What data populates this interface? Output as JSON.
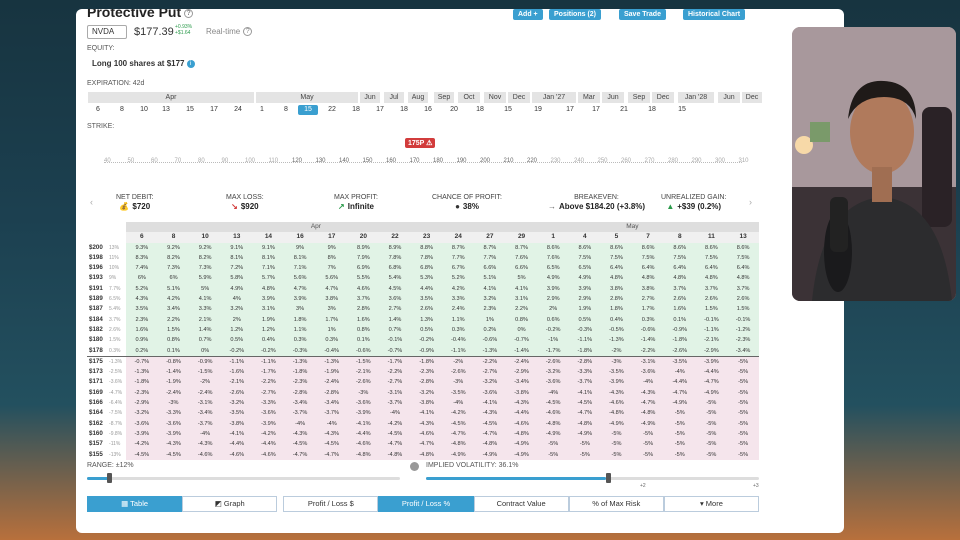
{
  "title": "Protective Put",
  "toolbar": [
    "Add +",
    "Positions (2)",
    "Save Trade",
    "Historical Chart"
  ],
  "ticker": "NVDA",
  "price": "$177.39",
  "change_pct": "+0.93%",
  "change_abs": "+$1.64",
  "realtime": "Real-time",
  "equity_label": "EQUITY:",
  "equity_value": "Long 100 shares at $177",
  "expiration_label": "EXPIRATION: 42d",
  "months": [
    "Apr",
    "May",
    "Jun",
    "Jul",
    "Aug",
    "Sep",
    "Oct",
    "Nov",
    "Dec",
    "Jan '27",
    "Mar",
    "Jun",
    "Sep",
    "Dec",
    "Jan '28",
    "Jun",
    "Dec"
  ],
  "dates": [
    "6",
    "8",
    "10",
    "13",
    "15",
    "17",
    "24",
    "1",
    "8",
    "15",
    "22",
    "18",
    "17",
    "18",
    "16",
    "20",
    "18",
    "15",
    "19",
    "17",
    "17",
    "21",
    "18",
    "15"
  ],
  "selected_date_index": 9,
  "strike_label": "STRIKE:",
  "strikes": [
    "40",
    "50",
    "60",
    "70",
    "80",
    "90",
    "100",
    "110",
    "120",
    "130",
    "140",
    "150",
    "160",
    "170",
    "180",
    "190",
    "200",
    "210",
    "220",
    "230",
    "240",
    "250",
    "260",
    "270",
    "280",
    "290",
    "300",
    "310"
  ],
  "strike_marker": "175P",
  "stats": [
    {
      "label": "NET DEBIT:",
      "value": "$720",
      "icon": "money-bag-icon"
    },
    {
      "label": "MAX LOSS:",
      "value": "$920",
      "icon": "down-arrow-icon"
    },
    {
      "label": "MAX PROFIT:",
      "value": "Infinite",
      "icon": "up-arrow-icon"
    },
    {
      "label": "CHANCE OF PROFIT:",
      "value": "38%",
      "icon": "dice-icon"
    },
    {
      "label": "BREAKEVEN:",
      "value": "Above $184.20 (+3.8%)",
      "icon": "arrow-right-icon"
    },
    {
      "label": "UNREALIZED GAIN:",
      "value": "+$39 (0.2%)",
      "icon": "triangle-up-icon"
    }
  ],
  "grid": {
    "month_headers": [
      {
        "label": "Apr",
        "span": 12
      },
      {
        "label": "May",
        "span": 8
      }
    ],
    "columns": [
      "6",
      "8",
      "10",
      "13",
      "14",
      "16",
      "17",
      "20",
      "22",
      "23",
      "24",
      "27",
      "29",
      "1",
      "4",
      "5",
      "7",
      "8",
      "11",
      "13",
      "15"
    ],
    "rows": [
      {
        "price": "$200",
        "pct": "13%",
        "vals": [
          "9.3%",
          "9.2%",
          "9.2%",
          "9.1%",
          "9.1%",
          "9%",
          "9%",
          "8.9%",
          "8.9%",
          "8.8%",
          "8.7%",
          "8.7%",
          "8.7%",
          "8.6%",
          "8.6%",
          "8.6%",
          "8.6%",
          "8.6%",
          "8.6%",
          "8.6%"
        ]
      },
      {
        "price": "$198",
        "pct": "11%",
        "vals": [
          "8.3%",
          "8.2%",
          "8.2%",
          "8.1%",
          "8.1%",
          "8.1%",
          "8%",
          "7.9%",
          "7.8%",
          "7.8%",
          "7.7%",
          "7.7%",
          "7.6%",
          "7.6%",
          "7.5%",
          "7.5%",
          "7.5%",
          "7.5%",
          "7.5%",
          "7.5%"
        ]
      },
      {
        "price": "$196",
        "pct": "10%",
        "vals": [
          "7.4%",
          "7.3%",
          "7.3%",
          "7.2%",
          "7.1%",
          "7.1%",
          "7%",
          "6.9%",
          "6.8%",
          "6.8%",
          "6.7%",
          "6.6%",
          "6.6%",
          "6.5%",
          "6.5%",
          "6.4%",
          "6.4%",
          "6.4%",
          "6.4%",
          "6.4%"
        ]
      },
      {
        "price": "$193",
        "pct": "9%",
        "vals": [
          "6%",
          "6%",
          "5.9%",
          "5.8%",
          "5.7%",
          "5.6%",
          "5.6%",
          "5.5%",
          "5.4%",
          "5.3%",
          "5.2%",
          "5.1%",
          "5%",
          "4.9%",
          "4.9%",
          "4.8%",
          "4.8%",
          "4.8%",
          "4.8%",
          "4.8%"
        ]
      },
      {
        "price": "$191",
        "pct": "7.7%",
        "vals": [
          "5.2%",
          "5.1%",
          "5%",
          "4.9%",
          "4.8%",
          "4.7%",
          "4.7%",
          "4.6%",
          "4.5%",
          "4.4%",
          "4.2%",
          "4.1%",
          "4.1%",
          "3.9%",
          "3.9%",
          "3.8%",
          "3.8%",
          "3.7%",
          "3.7%",
          "3.7%"
        ]
      },
      {
        "price": "$189",
        "pct": "6.5%",
        "vals": [
          "4.3%",
          "4.2%",
          "4.1%",
          "4%",
          "3.9%",
          "3.9%",
          "3.8%",
          "3.7%",
          "3.6%",
          "3.5%",
          "3.3%",
          "3.2%",
          "3.1%",
          "2.9%",
          "2.9%",
          "2.8%",
          "2.7%",
          "2.6%",
          "2.6%",
          "2.6%"
        ]
      },
      {
        "price": "$187",
        "pct": "5.4%",
        "vals": [
          "3.5%",
          "3.4%",
          "3.3%",
          "3.2%",
          "3.1%",
          "3%",
          "3%",
          "2.8%",
          "2.7%",
          "2.6%",
          "2.4%",
          "2.3%",
          "2.2%",
          "2%",
          "1.9%",
          "1.8%",
          "1.7%",
          "1.6%",
          "1.5%",
          "1.5%"
        ]
      },
      {
        "price": "$184",
        "pct": "3.7%",
        "vals": [
          "2.3%",
          "2.2%",
          "2.1%",
          "2%",
          "1.9%",
          "1.8%",
          "1.7%",
          "1.6%",
          "1.4%",
          "1.3%",
          "1.1%",
          "1%",
          "0.8%",
          "0.6%",
          "0.5%",
          "0.4%",
          "0.3%",
          "0.1%",
          "-0.1%",
          "-0.1%"
        ]
      },
      {
        "price": "$182",
        "pct": "2.6%",
        "vals": [
          "1.6%",
          "1.5%",
          "1.4%",
          "1.2%",
          "1.2%",
          "1.1%",
          "1%",
          "0.8%",
          "0.7%",
          "0.5%",
          "0.3%",
          "0.2%",
          "0%",
          "-0.2%",
          "-0.3%",
          "-0.5%",
          "-0.6%",
          "-0.9%",
          "-1.1%",
          "-1.2%"
        ]
      },
      {
        "price": "$180",
        "pct": "1.5%",
        "vals": [
          "0.9%",
          "0.8%",
          "0.7%",
          "0.5%",
          "0.4%",
          "0.3%",
          "0.3%",
          "0.1%",
          "-0.1%",
          "-0.2%",
          "-0.4%",
          "-0.6%",
          "-0.7%",
          "-1%",
          "-1.1%",
          "-1.3%",
          "-1.4%",
          "-1.8%",
          "-2.1%",
          "-2.3%"
        ]
      },
      {
        "price": "$178",
        "pct": "0.3%",
        "vals": [
          "0.2%",
          "0.1%",
          "0%",
          "-0.2%",
          "-0.2%",
          "-0.3%",
          "-0.4%",
          "-0.6%",
          "-0.7%",
          "-0.9%",
          "-1.1%",
          "-1.3%",
          "-1.4%",
          "-1.7%",
          "-1.8%",
          "-2%",
          "-2.2%",
          "-2.6%",
          "-2.9%",
          "-3.4%"
        ]
      },
      {
        "price": "$175",
        "pct": "-1.3%",
        "vals": [
          "-0.7%",
          "-0.8%",
          "-0.9%",
          "-1.1%",
          "-1.1%",
          "-1.3%",
          "-1.3%",
          "-1.5%",
          "-1.7%",
          "-1.8%",
          "-2%",
          "-2.2%",
          "-2.4%",
          "-2.6%",
          "-2.8%",
          "-3%",
          "-3.1%",
          "-3.5%",
          "-3.9%",
          "-5%"
        ]
      },
      {
        "price": "$173",
        "pct": "-2.5%",
        "vals": [
          "-1.3%",
          "-1.4%",
          "-1.5%",
          "-1.6%",
          "-1.7%",
          "-1.8%",
          "-1.9%",
          "-2.1%",
          "-2.2%",
          "-2.3%",
          "-2.6%",
          "-2.7%",
          "-2.9%",
          "-3.2%",
          "-3.3%",
          "-3.5%",
          "-3.6%",
          "-4%",
          "-4.4%",
          "-5%"
        ]
      },
      {
        "price": "$171",
        "pct": "-3.6%",
        "vals": [
          "-1.8%",
          "-1.9%",
          "-2%",
          "-2.1%",
          "-2.2%",
          "-2.3%",
          "-2.4%",
          "-2.6%",
          "-2.7%",
          "-2.8%",
          "-3%",
          "-3.2%",
          "-3.4%",
          "-3.6%",
          "-3.7%",
          "-3.9%",
          "-4%",
          "-4.4%",
          "-4.7%",
          "-5%"
        ]
      },
      {
        "price": "$169",
        "pct": "-4.7%",
        "vals": [
          "-2.3%",
          "-2.4%",
          "-2.4%",
          "-2.6%",
          "-2.7%",
          "-2.8%",
          "-2.8%",
          "-3%",
          "-3.1%",
          "-3.2%",
          "-3.5%",
          "-3.6%",
          "-3.8%",
          "-4%",
          "-4.1%",
          "-4.3%",
          "-4.3%",
          "-4.7%",
          "-4.9%",
          "-5%"
        ]
      },
      {
        "price": "$166",
        "pct": "-6.4%",
        "vals": [
          "-2.9%",
          "-3%",
          "-3.1%",
          "-3.2%",
          "-3.3%",
          "-3.4%",
          "-3.4%",
          "-3.6%",
          "-3.7%",
          "-3.8%",
          "-4%",
          "-4.1%",
          "-4.3%",
          "-4.5%",
          "-4.5%",
          "-4.6%",
          "-4.7%",
          "-4.9%",
          "-5%",
          "-5%"
        ]
      },
      {
        "price": "$164",
        "pct": "-7.5%",
        "vals": [
          "-3.2%",
          "-3.3%",
          "-3.4%",
          "-3.5%",
          "-3.6%",
          "-3.7%",
          "-3.7%",
          "-3.9%",
          "-4%",
          "-4.1%",
          "-4.2%",
          "-4.3%",
          "-4.4%",
          "-4.6%",
          "-4.7%",
          "-4.8%",
          "-4.8%",
          "-5%",
          "-5%",
          "-5%"
        ]
      },
      {
        "price": "$162",
        "pct": "-8.7%",
        "vals": [
          "-3.6%",
          "-3.6%",
          "-3.7%",
          "-3.8%",
          "-3.9%",
          "-4%",
          "-4%",
          "-4.1%",
          "-4.2%",
          "-4.3%",
          "-4.5%",
          "-4.5%",
          "-4.6%",
          "-4.8%",
          "-4.8%",
          "-4.9%",
          "-4.9%",
          "-5%",
          "-5%",
          "-5%"
        ]
      },
      {
        "price": "$160",
        "pct": "-9.8%",
        "vals": [
          "-3.9%",
          "-3.9%",
          "-4%",
          "-4.1%",
          "-4.2%",
          "-4.3%",
          "-4.3%",
          "-4.4%",
          "-4.5%",
          "-4.6%",
          "-4.7%",
          "-4.7%",
          "-4.8%",
          "-4.9%",
          "-4.9%",
          "-5%",
          "-5%",
          "-5%",
          "-5%",
          "-5%"
        ]
      },
      {
        "price": "$157",
        "pct": "-11%",
        "vals": [
          "-4.2%",
          "-4.3%",
          "-4.3%",
          "-4.4%",
          "-4.4%",
          "-4.5%",
          "-4.5%",
          "-4.6%",
          "-4.7%",
          "-4.7%",
          "-4.8%",
          "-4.8%",
          "-4.9%",
          "-5%",
          "-5%",
          "-5%",
          "-5%",
          "-5%",
          "-5%",
          "-5%"
        ]
      },
      {
        "price": "$155",
        "pct": "-13%",
        "vals": [
          "-4.5%",
          "-4.5%",
          "-4.6%",
          "-4.6%",
          "-4.6%",
          "-4.7%",
          "-4.7%",
          "-4.8%",
          "-4.8%",
          "-4.8%",
          "-4.9%",
          "-4.9%",
          "-4.9%",
          "-5%",
          "-5%",
          "-5%",
          "-5%",
          "-5%",
          "-5%",
          "-5%"
        ]
      }
    ]
  },
  "range_label": "RANGE: ±12%",
  "range_fraction": 0.07,
  "iv_label": "IMPLIED VOLATILITY: 36.1%",
  "iv_fraction": 0.32,
  "iv_ticks": [
    "+2",
    "+3"
  ],
  "bottom_buttons": [
    {
      "label": "Table",
      "on": true
    },
    {
      "label": "Graph",
      "on": false
    },
    {
      "label": "Profit / Loss $",
      "on": false
    },
    {
      "label": "Profit / Loss %",
      "on": true
    },
    {
      "label": "Contract Value",
      "on": false
    },
    {
      "label": "% of Max Risk",
      "on": false
    },
    {
      "label": "More",
      "on": false
    }
  ]
}
